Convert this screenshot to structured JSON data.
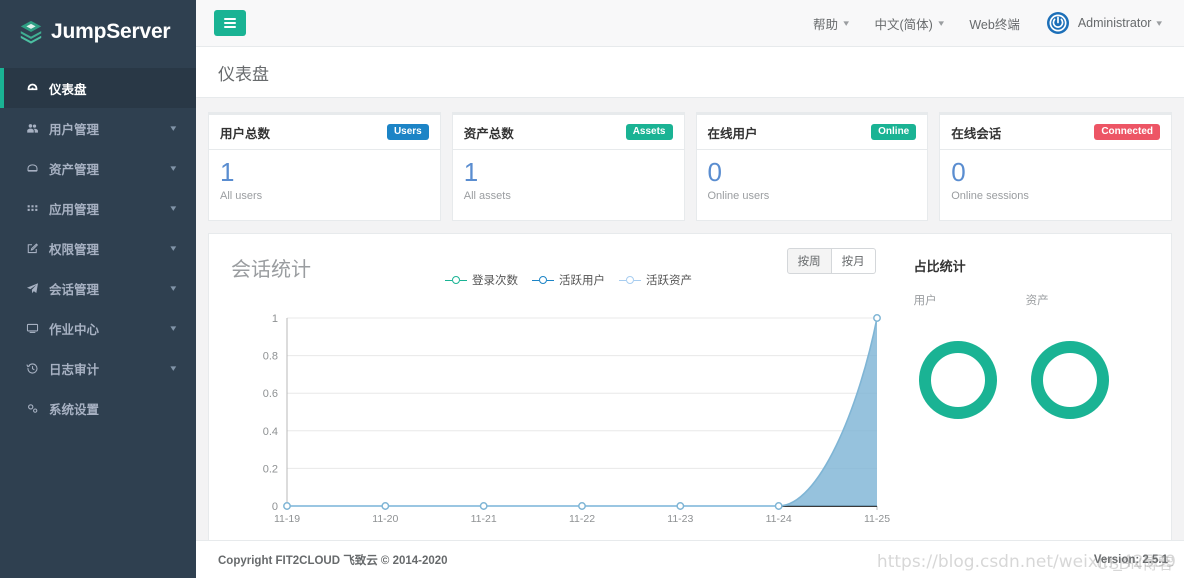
{
  "brand": {
    "name": "JumpServer",
    "logo_icon": "jumpserver-stack-logo"
  },
  "sidebar": {
    "items": [
      {
        "label": "仪表盘",
        "icon": "dashboard-icon",
        "active": true,
        "expandable": false
      },
      {
        "label": "用户管理",
        "icon": "users-icon",
        "active": false,
        "expandable": true
      },
      {
        "label": "资产管理",
        "icon": "assets-icon",
        "active": false,
        "expandable": true
      },
      {
        "label": "应用管理",
        "icon": "apps-grid-icon",
        "active": false,
        "expandable": true
      },
      {
        "label": "权限管理",
        "icon": "permission-icon",
        "active": false,
        "expandable": true
      },
      {
        "label": "会话管理",
        "icon": "paper-plane-icon",
        "active": false,
        "expandable": true
      },
      {
        "label": "作业中心",
        "icon": "terminal-icon",
        "active": false,
        "expandable": true
      },
      {
        "label": "日志审计",
        "icon": "history-icon",
        "active": false,
        "expandable": true
      },
      {
        "label": "系统设置",
        "icon": "gears-icon",
        "active": false,
        "expandable": false
      }
    ]
  },
  "topbar": {
    "menu_toggle_icon": "hamburger-icon",
    "help": "帮助",
    "language": "中文(简体)",
    "web_terminal": "Web终端",
    "user": "Administrator",
    "avatar_icon": "power-user-icon",
    "caret_icon": "chevron-down-icon"
  },
  "page": {
    "title": "仪表盘"
  },
  "cards": [
    {
      "title": "用户总数",
      "badge": "Users",
      "badge_color": "#1c84c6",
      "value": "1",
      "subtitle": "All users"
    },
    {
      "title": "资产总数",
      "badge": "Assets",
      "badge_color": "#1ab394",
      "value": "1",
      "subtitle": "All assets"
    },
    {
      "title": "在线用户",
      "badge": "Online",
      "badge_color": "#1ab394",
      "value": "0",
      "subtitle": "Online users"
    },
    {
      "title": "在线会话",
      "badge": "Connected",
      "badge_color": "#ed5565",
      "value": "0",
      "subtitle": "Online sessions"
    }
  ],
  "session_panel": {
    "title": "会话统计",
    "period_buttons": [
      {
        "label": "按周",
        "selected": true
      },
      {
        "label": "按月",
        "selected": false
      }
    ]
  },
  "proportion_panel": {
    "title": "占比统计",
    "donuts": [
      {
        "label": "用户",
        "color": "#1ab394",
        "percent": 100
      },
      {
        "label": "资产",
        "color": "#1ab394",
        "percent": 100
      }
    ]
  },
  "footer": {
    "copyright": "Copyright FIT2CLOUD 飞致云 © 2014-2020",
    "version": "Version: 2.5.1"
  },
  "watermark": {
    "url": "https://blog.csdn.net/weixin_42539",
    "site": "CSDN博客"
  },
  "chart_data": {
    "type": "line",
    "title": "会话统计",
    "xlabel": "",
    "ylabel": "",
    "ylim": [
      0,
      1
    ],
    "yticks": [
      "0",
      "0.2",
      "0.4",
      "0.6",
      "0.8",
      "1"
    ],
    "categories": [
      "11-19",
      "11-20",
      "11-21",
      "11-22",
      "11-23",
      "11-24",
      "11-25"
    ],
    "grid": true,
    "legend_position": "top-center",
    "series": [
      {
        "name": "登录次数",
        "color": "#1ab394",
        "values": [
          0,
          0,
          0,
          0,
          0,
          0,
          0
        ]
      },
      {
        "name": "活跃用户",
        "color": "#1c84c6",
        "values": [
          0,
          0,
          0,
          0,
          0,
          0,
          0
        ]
      },
      {
        "name": "活跃资产",
        "color": "#a7cdf0",
        "values": [
          0,
          0,
          0,
          0,
          0,
          0,
          1
        ]
      }
    ],
    "area_fill": "#7fb5d5"
  }
}
